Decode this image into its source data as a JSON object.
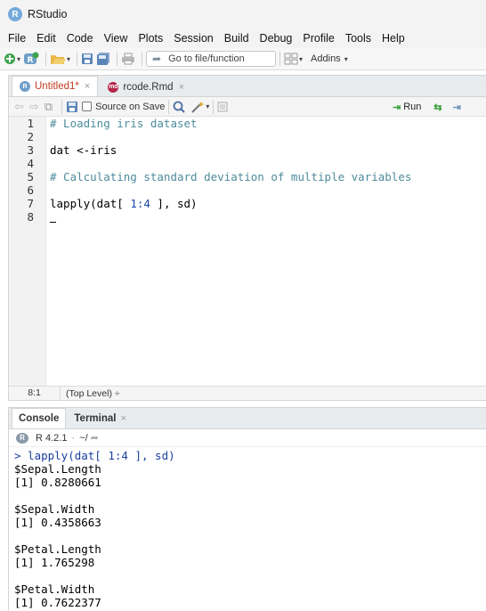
{
  "window": {
    "title": "RStudio",
    "logo_letter": "R"
  },
  "menu": [
    "File",
    "Edit",
    "Code",
    "View",
    "Plots",
    "Session",
    "Build",
    "Debug",
    "Profile",
    "Tools",
    "Help"
  ],
  "toolbar": {
    "goto_placeholder": "Go to file/function",
    "addins_label": "Addins"
  },
  "source": {
    "tabs": [
      {
        "label": "Untitled1*",
        "active": true
      },
      {
        "label": "rcode.Rmd",
        "active": false
      }
    ],
    "source_on_save": "Source on Save",
    "run_label": "Run",
    "lines": [
      {
        "num": "1",
        "text": "# Loading iris dataset",
        "kind": "comment"
      },
      {
        "num": "2",
        "text": "",
        "kind": "code"
      },
      {
        "num": "3",
        "text": "dat <-iris",
        "kind": "code"
      },
      {
        "num": "4",
        "text": "",
        "kind": "code"
      },
      {
        "num": "5",
        "text": "# Calculating standard deviation of multiple variables",
        "kind": "comment"
      },
      {
        "num": "6",
        "text": "",
        "kind": "code"
      },
      {
        "num": "7",
        "text_pre": "lapply(dat[ ",
        "text_num": "1:4",
        "text_post": " ], sd)",
        "kind": "mixed"
      },
      {
        "num": "8",
        "text": "",
        "kind": "code"
      }
    ],
    "status_position": "8:1",
    "status_scope": "(Top Level) ÷"
  },
  "console": {
    "tabs": [
      {
        "label": "Console",
        "active": true
      },
      {
        "label": "Terminal",
        "active": false
      }
    ],
    "r_version": "R 4.2.1",
    "wd": "~/",
    "output": [
      {
        "text": "> lapply(dat[ 1:4 ], sd)",
        "kind": "prompt"
      },
      {
        "text": "$Sepal.Length",
        "kind": "out"
      },
      {
        "text": "[1] 0.8280661",
        "kind": "out"
      },
      {
        "text": "",
        "kind": "out"
      },
      {
        "text": "$Sepal.Width",
        "kind": "out"
      },
      {
        "text": "[1] 0.4358663",
        "kind": "out"
      },
      {
        "text": "",
        "kind": "out"
      },
      {
        "text": "$Petal.Length",
        "kind": "out"
      },
      {
        "text": "[1] 1.765298",
        "kind": "out"
      },
      {
        "text": "",
        "kind": "out"
      },
      {
        "text": "$Petal.Width",
        "kind": "out"
      },
      {
        "text": "[1] 0.7622377",
        "kind": "out"
      }
    ]
  }
}
